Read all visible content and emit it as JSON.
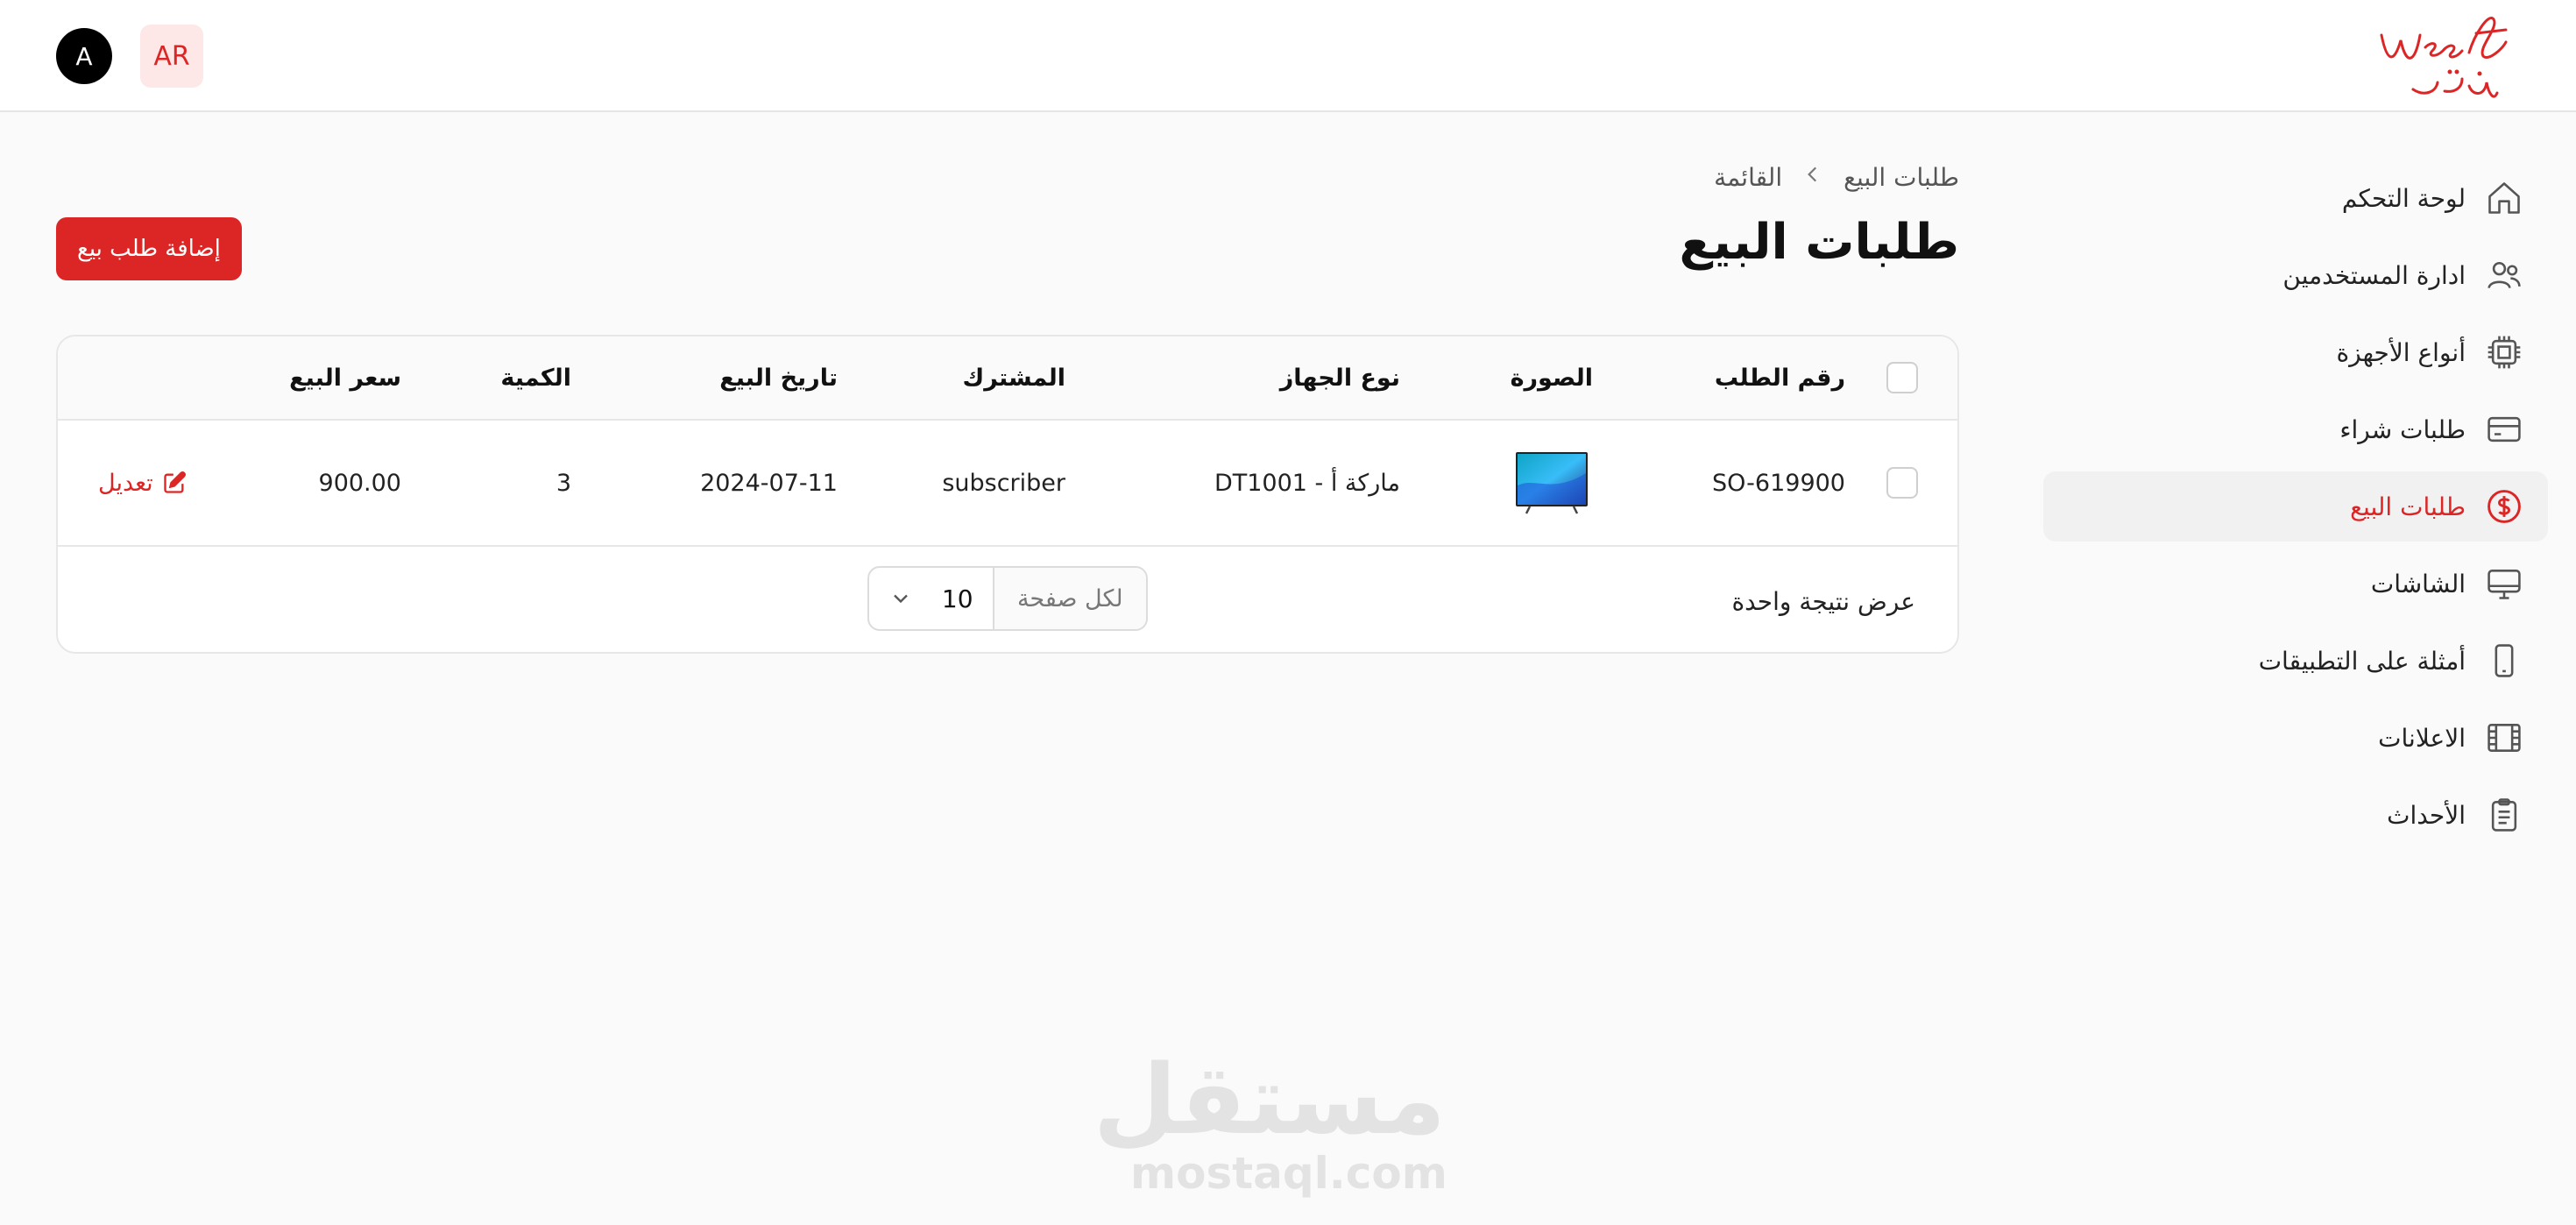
{
  "brand": {
    "logo_latin": "Weeqt",
    "logo_arabic": "وقت",
    "accent": "#dc2626"
  },
  "header": {
    "avatar_initial": "A",
    "lang_label": "AR"
  },
  "sidebar": {
    "items": [
      {
        "label": "لوحة التحكم",
        "icon": "home-icon"
      },
      {
        "label": "ادارة المستخدمين",
        "icon": "users-icon"
      },
      {
        "label": "أنواع الأجهزة",
        "icon": "chip-icon"
      },
      {
        "label": "طلبات شراء",
        "icon": "credit-card-icon"
      },
      {
        "label": "طلبات البيع",
        "icon": "dollar-circle-icon",
        "active": true
      },
      {
        "label": "الشاشات",
        "icon": "monitor-icon"
      },
      {
        "label": "أمثلة على التطبيقات",
        "icon": "phone-icon"
      },
      {
        "label": "الاعلانات",
        "icon": "film-icon"
      },
      {
        "label": "الأحداث",
        "icon": "clipboard-icon"
      }
    ]
  },
  "breadcrumb": {
    "root": "طلبات البيع",
    "current": "القائمة"
  },
  "page": {
    "title": "طلبات البيع",
    "add_button": "إضافة طلب بيع"
  },
  "table": {
    "columns": {
      "order_no": "رقم الطلب",
      "image": "الصورة",
      "device_type": "نوع الجهاز",
      "subscriber": "المشترك",
      "sale_date": "تاريخ البيع",
      "quantity": "الكمية",
      "price": "سعر البيع"
    },
    "rows": [
      {
        "order_no": "SO-619900",
        "device_type": "ماركة أ - DT1001",
        "subscriber": "subscriber",
        "sale_date": "2024-07-11",
        "quantity": "3",
        "price": "900.00",
        "edit_label": "تعديل"
      }
    ]
  },
  "pagination": {
    "result_text": "عرض نتيجة واحدة",
    "per_page_label": "لكل صفحة",
    "per_page_value": "10"
  },
  "watermark": {
    "arabic": "مستقل",
    "latin": "mostaql.com"
  }
}
